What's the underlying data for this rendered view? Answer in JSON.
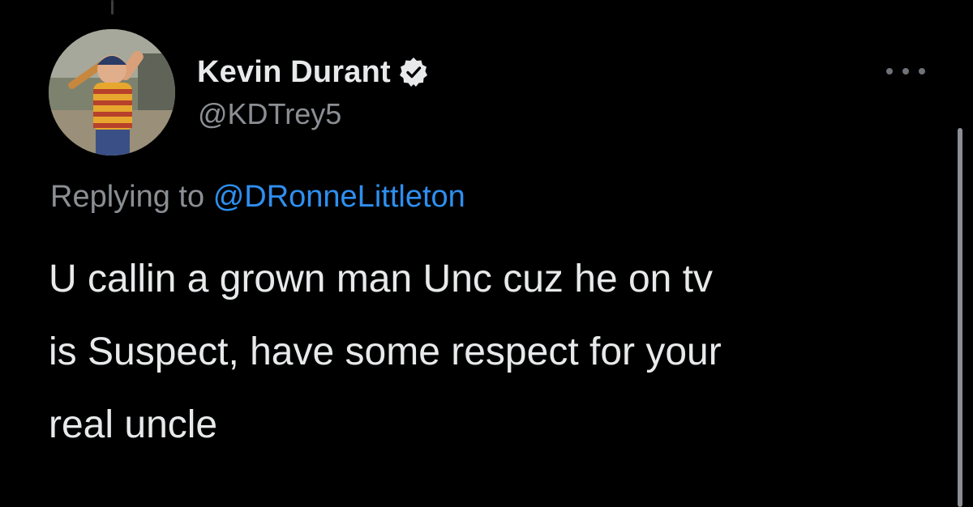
{
  "tweet": {
    "author": {
      "display_name": "Kevin Durant",
      "handle": "@KDTrey5",
      "verified": true,
      "verified_icon": "verified-badge-icon"
    },
    "reply": {
      "prefix": "Replying to",
      "mention": "@DRonneLittleton"
    },
    "text_lines": [
      "U callin a grown man Unc cuz he on tv",
      "is Suspect, have some respect for your",
      "real uncle"
    ],
    "more_icon": "more-options-icon"
  },
  "colors": {
    "background": "#000000",
    "primary_text": "#e7e9ea",
    "secondary_text": "#8b8f94",
    "link": "#2e8ff0"
  }
}
